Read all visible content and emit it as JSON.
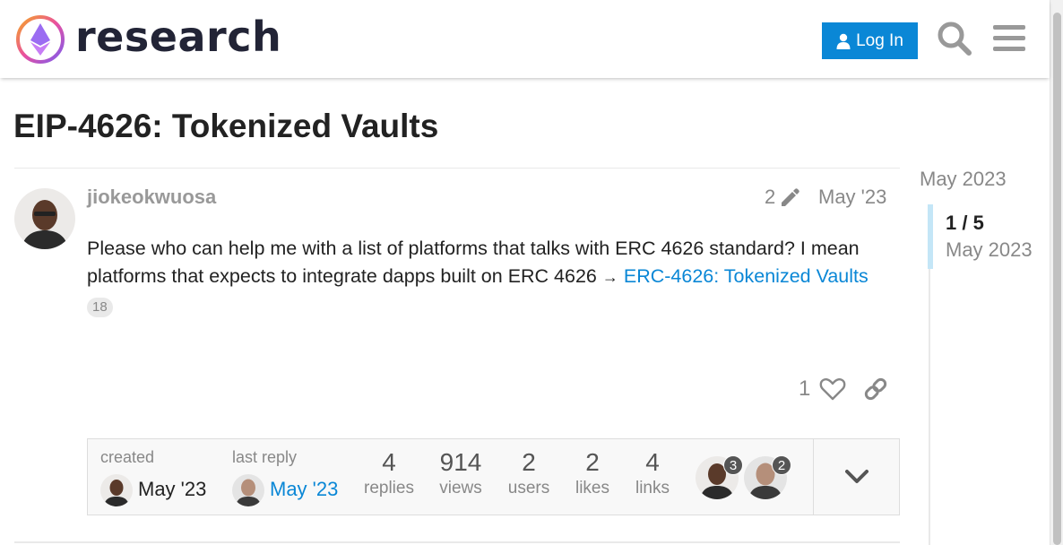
{
  "header": {
    "brand": "research",
    "login_label": "Log In",
    "search_icon": "search-icon",
    "menu_icon": "hamburger-menu-icon",
    "accent_color": "#0a87d6"
  },
  "topic": {
    "title": "EIP-4626: Tokenized Vaults"
  },
  "post": {
    "username": "jiokeokwuosa",
    "edit_count": "2",
    "date": "May '23",
    "body_text": "Please who can help me with a list of platforms that talks with ERC 4626 standard? I mean platforms that expects to integrate dapps built on ERC 4626",
    "arrow": "→",
    "link_text": "ERC-4626: Tokenized Vaults",
    "link_clicks": "18",
    "likes": "1"
  },
  "topic_map": {
    "created_label": "created",
    "created_date": "May '23",
    "last_reply_label": "last reply",
    "last_reply_date": "May '23",
    "stats": {
      "replies": {
        "num": "4",
        "label": "replies"
      },
      "views": {
        "num": "914",
        "label": "views"
      },
      "users": {
        "num": "2",
        "label": "users"
      },
      "likes": {
        "num": "2",
        "label": "likes"
      },
      "links": {
        "num": "4",
        "label": "links"
      }
    },
    "participants": [
      {
        "count": "3"
      },
      {
        "count": "2"
      }
    ]
  },
  "timeline": {
    "start_label": "May 2023",
    "position": "1 / 5",
    "position_date": "May 2023"
  }
}
